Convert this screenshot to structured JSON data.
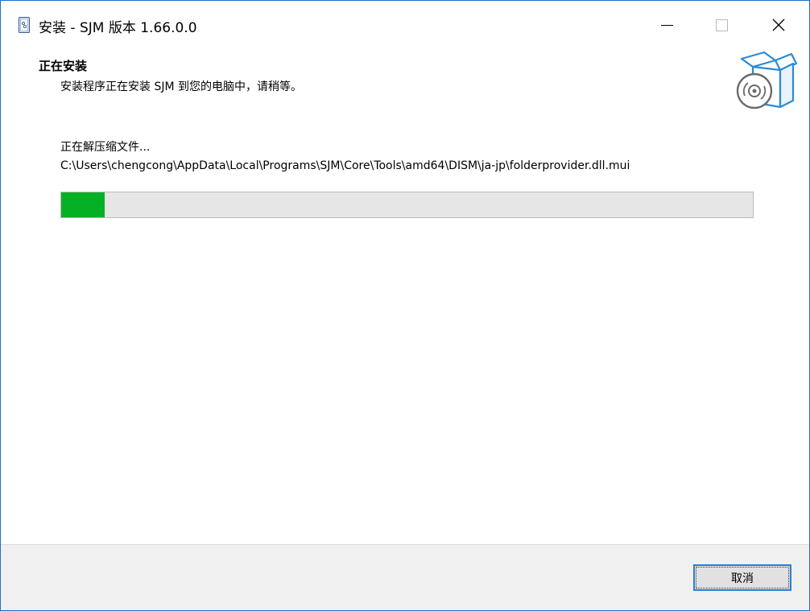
{
  "window": {
    "title": "安装 - SJM 版本 1.66.0.0",
    "controls": {
      "minimize_icon": "minimize-icon",
      "maximize_icon": "maximize-icon",
      "close_icon": "close-icon"
    }
  },
  "header": {
    "title": "正在安装",
    "subtitle": "安装程序正在安装 SJM 到您的电脑中，请稍等。",
    "icon": "box-with-disc-icon"
  },
  "main": {
    "status_text": "正在解压缩文件...",
    "current_file": "C:\\Users\\chengcong\\AppData\\Local\\Programs\\SJM\\Core\\Tools\\amd64\\DISM\\ja-jp\\folderprovider.dll.mui",
    "progress_fraction": 0.063
  },
  "footer": {
    "cancel_label": "取消"
  },
  "colors": {
    "accent": "#1e6fc8",
    "progress_fill": "#06b025",
    "progress_track": "#e6e6e6",
    "footer_bg": "#f0f0f0"
  }
}
